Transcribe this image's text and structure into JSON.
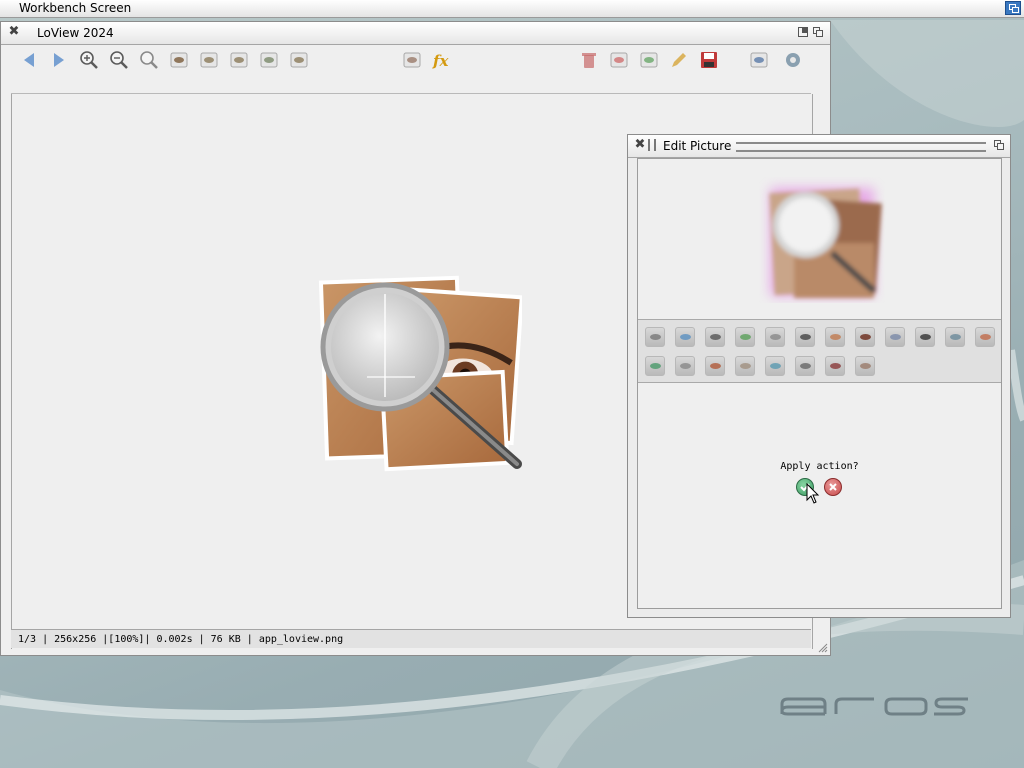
{
  "screen": {
    "title": "Workbench Screen"
  },
  "main_window": {
    "title": "LoView 2024",
    "toolbar": [
      {
        "name": "back-arrow-icon"
      },
      {
        "name": "forward-arrow-icon"
      },
      {
        "name": "zoom-in-icon"
      },
      {
        "name": "zoom-out-icon"
      },
      {
        "name": "zoom-reset-icon"
      },
      {
        "name": "fit-image-icon"
      },
      {
        "name": "rotate-left-icon"
      },
      {
        "name": "rotate-right-icon"
      },
      {
        "name": "flip-icon"
      },
      {
        "name": "mirror-icon"
      },
      {
        "name": "slideshow-icon"
      },
      {
        "name": "fx-icon"
      },
      {
        "name": "trash-icon"
      },
      {
        "name": "undo-icon"
      },
      {
        "name": "redo-icon"
      },
      {
        "name": "edit-pencil-icon"
      },
      {
        "name": "save-disk-icon"
      },
      {
        "name": "clipboard-icon"
      },
      {
        "name": "settings-icon"
      }
    ],
    "status": "1/3 | 256x256 |[100%]| 0.002s | 76 KB | app_loview.png"
  },
  "edit_window": {
    "title": "Edit Picture",
    "effects": [
      {
        "name": "effect-grayscale"
      },
      {
        "name": "effect-sepia"
      },
      {
        "name": "effect-cut"
      },
      {
        "name": "effect-crop"
      },
      {
        "name": "effect-noise"
      },
      {
        "name": "effect-pixelate"
      },
      {
        "name": "effect-warm"
      },
      {
        "name": "effect-dark"
      },
      {
        "name": "effect-cool"
      },
      {
        "name": "effect-contrast"
      },
      {
        "name": "effect-tint"
      },
      {
        "name": "effect-swirl"
      },
      {
        "name": "effect-green"
      },
      {
        "name": "effect-gray-eye"
      },
      {
        "name": "effect-red-eye"
      },
      {
        "name": "effect-desaturate"
      },
      {
        "name": "effect-cyan"
      },
      {
        "name": "effect-stripes"
      },
      {
        "name": "effect-brighten"
      },
      {
        "name": "effect-waves"
      }
    ],
    "apply_prompt": "Apply action?",
    "confirm": {
      "icon": "checkmark-icon"
    },
    "cancel": {
      "icon": "cancel-x-icon"
    }
  },
  "desktop": {
    "logo": "aros"
  },
  "colors": {
    "accent": "#3a78c0",
    "confirm": "#3d9b63",
    "cancel": "#c94a4a"
  }
}
